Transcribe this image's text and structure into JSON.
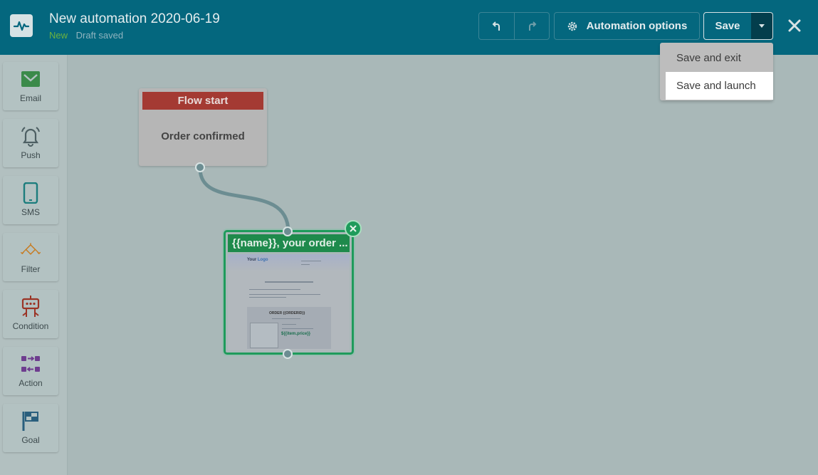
{
  "header": {
    "title": "New automation 2020-06-19",
    "status_new": "New",
    "status_draft": "Draft saved",
    "automation_options_label": "Automation options",
    "save_label": "Save"
  },
  "save_dropdown": {
    "items": [
      {
        "label": "Save and exit"
      },
      {
        "label": "Save and launch"
      }
    ]
  },
  "sidebar": {
    "items": [
      {
        "label": "Email",
        "icon": "envelope-icon",
        "color": "#3b8a4a"
      },
      {
        "label": "Push",
        "icon": "bell-icon",
        "color": "#4d5f63"
      },
      {
        "label": "SMS",
        "icon": "phone-icon",
        "color": "#1c7d7d"
      },
      {
        "label": "Filter",
        "icon": "filter-icon",
        "color": "#c77a1e"
      },
      {
        "label": "Condition",
        "icon": "condition-icon",
        "color": "#9b3426"
      },
      {
        "label": "Action",
        "icon": "action-icon",
        "color": "#6e3d8f"
      },
      {
        "label": "Goal",
        "icon": "flag-icon",
        "color": "#2a5f7d"
      }
    ]
  },
  "canvas": {
    "flow_start": {
      "header": "Flow start",
      "trigger": "Order confirmed"
    },
    "email_node": {
      "subject": "{{name}}, your order ...",
      "preview_logo_a": "Your ",
      "preview_logo_b": "Logo",
      "preview_order": "ORDER {{ORDERID}}",
      "preview_price": "${{item.price}}"
    }
  },
  "colors": {
    "header_bg": "#04677e",
    "flow_start_accent": "#a43a33",
    "email_accent": "#1e8a4c",
    "canvas_bg": "#a9b8b8"
  }
}
